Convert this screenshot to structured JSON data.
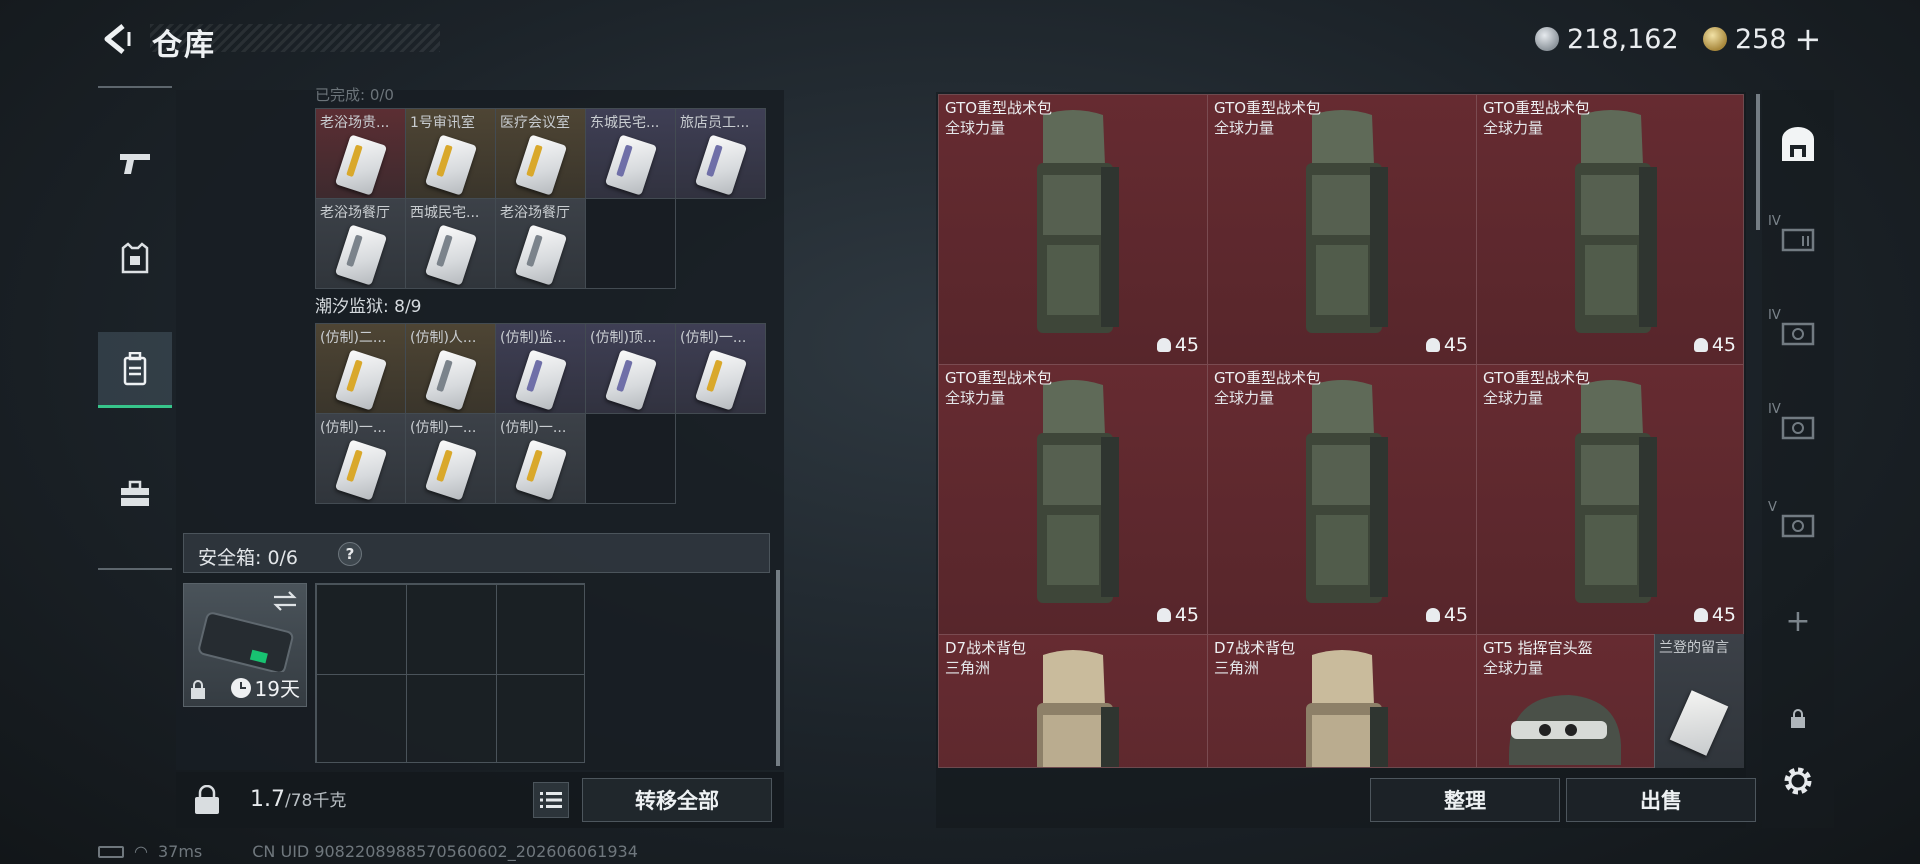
{
  "header": {
    "title": "仓库",
    "currency_silver": "218,162",
    "currency_gold": "258",
    "plus_label": "+"
  },
  "left_nav": {
    "items": [
      {
        "icon": "pistol-icon"
      },
      {
        "icon": "armor-vest-icon"
      },
      {
        "icon": "backpack-icon",
        "active": true
      },
      {
        "icon": "toolbox-icon"
      }
    ]
  },
  "stash": {
    "faded_section_title": "已完成: 0/0",
    "section1": {
      "cells": [
        {
          "label": "老浴场贵...",
          "rarity": "red"
        },
        {
          "label": "1号审讯室",
          "rarity": "gold"
        },
        {
          "label": "医疗会议室",
          "rarity": "gold"
        },
        {
          "label": "东城民宅...",
          "rarity": "purple"
        },
        {
          "label": "旅店员工...",
          "rarity": "purple"
        },
        {
          "label": "老浴场餐厅",
          "rarity": "silver"
        },
        {
          "label": "西城民宅...",
          "rarity": "silver"
        },
        {
          "label": "老浴场餐厅",
          "rarity": "silver"
        }
      ]
    },
    "section2": {
      "title": "潮汐监狱: 8/9",
      "cells": [
        {
          "label": "(仿制)二...",
          "rarity": "gold"
        },
        {
          "label": "(仿制)人...",
          "rarity": "gold"
        },
        {
          "label": "(仿制)监...",
          "rarity": "purple"
        },
        {
          "label": "(仿制)顶...",
          "rarity": "purple"
        },
        {
          "label": "(仿制)一...",
          "rarity": "purple"
        },
        {
          "label": "(仿制)一...",
          "rarity": "silver"
        },
        {
          "label": "(仿制)一...",
          "rarity": "silver"
        },
        {
          "label": "(仿制)一...",
          "rarity": "silver"
        }
      ]
    },
    "safe_box": {
      "label": "安全箱: 0/6",
      "help": "?",
      "days": "19天"
    },
    "weight": {
      "current": "1.7",
      "max": "/78千克"
    },
    "transfer_all_label": "转移全部"
  },
  "status_bar": {
    "ping": "37ms",
    "uid": "CN UID 9082208988570560602_202606061934"
  },
  "container": {
    "bags": [
      {
        "name": "GTO重型战术包",
        "maker": "全球力量",
        "count": "45",
        "color": "green"
      },
      {
        "name": "GTO重型战术包",
        "maker": "全球力量",
        "count": "45",
        "color": "green"
      },
      {
        "name": "GTO重型战术包",
        "maker": "全球力量",
        "count": "45",
        "color": "green"
      },
      {
        "name": "GTO重型战术包",
        "maker": "全球力量",
        "count": "45",
        "color": "green"
      },
      {
        "name": "GTO重型战术包",
        "maker": "全球力量",
        "count": "45",
        "color": "green"
      },
      {
        "name": "GTO重型战术包",
        "maker": "全球力量",
        "count": "45",
        "color": "green"
      },
      {
        "name": "D7战术背包",
        "maker": "三角洲",
        "color": "tan"
      },
      {
        "name": "D7战术背包",
        "maker": "三角洲",
        "color": "tan"
      }
    ],
    "helmet": {
      "name": "GT5 指挥官头盔",
      "maker": "全球力量"
    },
    "note": {
      "name": "兰登的留言"
    },
    "sort_label": "整理",
    "sell_label": "出售"
  },
  "right_rail": {
    "items": [
      {
        "icon": "backpack-slot-icon",
        "label": ""
      },
      {
        "icon": "case-iv-icon",
        "label": "IV"
      },
      {
        "icon": "case-iv-icon",
        "label": "IV"
      },
      {
        "icon": "case-iv-icon",
        "label": "IV"
      },
      {
        "icon": "case-v-icon",
        "label": "V"
      }
    ],
    "add_label": "+"
  },
  "colors": {
    "accent_green": "#37c58b",
    "container_red": "#662b31",
    "gold_rarity": "#d9a82b"
  }
}
